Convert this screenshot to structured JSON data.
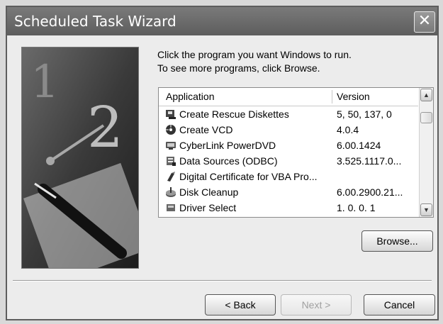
{
  "window": {
    "title": "Scheduled Task Wizard"
  },
  "titlebar": {
    "close_icon": "close-icon"
  },
  "instructions": {
    "line1": "Click the program you want Windows to run.",
    "line2": "To see more programs, click Browse."
  },
  "list": {
    "columns": [
      "Application",
      "Version"
    ],
    "rows": [
      {
        "icon": "rescue-diskettes-icon",
        "name": "Create Rescue Diskettes",
        "version": "5, 50, 137, 0"
      },
      {
        "icon": "vcd-disc-icon",
        "name": "Create VCD",
        "version": "4.0.4"
      },
      {
        "icon": "dvd-player-icon",
        "name": "CyberLink PowerDVD",
        "version": "6.00.1424"
      },
      {
        "icon": "database-icon",
        "name": "Data Sources (ODBC)",
        "version": "3.525.1117.0..."
      },
      {
        "icon": "certificate-icon",
        "name": "Digital Certificate for VBA Pro...",
        "version": ""
      },
      {
        "icon": "disk-cleanup-icon",
        "name": "Disk Cleanup",
        "version": "6.00.2900.21..."
      },
      {
        "icon": "driver-icon",
        "name": "Driver Select",
        "version": "1. 0. 0. 1"
      }
    ]
  },
  "buttons": {
    "browse": "Browse...",
    "back": "< Back",
    "next": "Next >",
    "cancel": "Cancel"
  }
}
